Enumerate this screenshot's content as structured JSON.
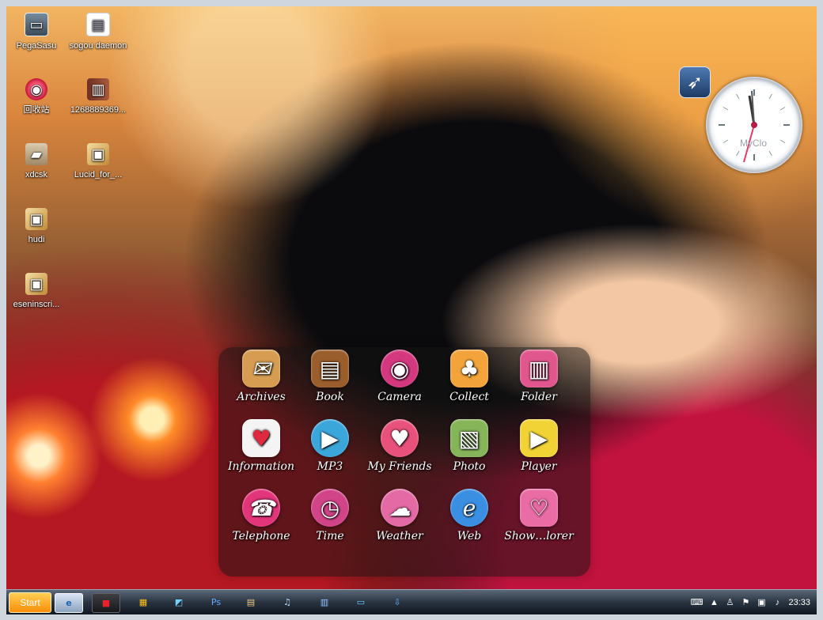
{
  "desktop": {
    "icons": [
      {
        "label": "PegaSasu",
        "icon": "monitor-icon"
      },
      {
        "label": "sogou daemon",
        "icon": "document-icon"
      },
      {
        "label": "回收站",
        "icon": "recycle-bin-icon"
      },
      {
        "label": "1268889369...",
        "icon": "archive-icon"
      },
      {
        "label": "xdcsk",
        "icon": "folder-icon"
      },
      {
        "label": "Lucid_for_...",
        "icon": "package-icon"
      },
      {
        "label": "hudi",
        "icon": "package-icon"
      },
      {
        "label": "eseninscri...",
        "icon": "package-icon"
      }
    ]
  },
  "launcher": {
    "apps": [
      {
        "label": "Archives",
        "icon": "archives-icon",
        "color": "#d69d52"
      },
      {
        "label": "Book",
        "icon": "book-icon",
        "color": "#9a5d2c"
      },
      {
        "label": "Camera",
        "icon": "camera-icon",
        "color": "#d4387f"
      },
      {
        "label": "Collect",
        "icon": "collect-icon",
        "color": "#f2a43a"
      },
      {
        "label": "Folder",
        "icon": "folder-icon",
        "color": "#e1578d"
      },
      {
        "label": "Information",
        "icon": "information-icon",
        "color": "#f4f4f4"
      },
      {
        "label": "MP3",
        "icon": "mp3-icon",
        "color": "#3ba6da"
      },
      {
        "label": "My Friends",
        "icon": "friends-icon",
        "color": "#e8517c"
      },
      {
        "label": "Photo",
        "icon": "photo-icon",
        "color": "#86b459"
      },
      {
        "label": "Player",
        "icon": "player-icon",
        "color": "#f1d336"
      },
      {
        "label": "Telephone",
        "icon": "telephone-icon",
        "color": "#e2357a"
      },
      {
        "label": "Time",
        "icon": "time-icon",
        "color": "#d24488"
      },
      {
        "label": "Weather",
        "icon": "weather-icon",
        "color": "#e46aa5"
      },
      {
        "label": "Web",
        "icon": "web-icon",
        "color": "#3b8fe2"
      },
      {
        "label": "Show…lorer",
        "icon": "show-icon",
        "color": "#ea6ca5"
      }
    ]
  },
  "clock": {
    "label": "MyClo"
  },
  "taskbar": {
    "start": "Start",
    "tray_time": "23:33",
    "tasks": [
      {
        "icon": "ie-icon"
      },
      {
        "icon": "red-square-icon"
      },
      {
        "icon": "windows-logo-icon"
      },
      {
        "icon": "image-viewer-icon"
      },
      {
        "icon": "photoshop-icon"
      },
      {
        "icon": "tools-icon"
      },
      {
        "icon": "music-icon"
      },
      {
        "icon": "chart-icon"
      },
      {
        "icon": "chat-icon"
      },
      {
        "icon": "download-icon"
      }
    ]
  }
}
